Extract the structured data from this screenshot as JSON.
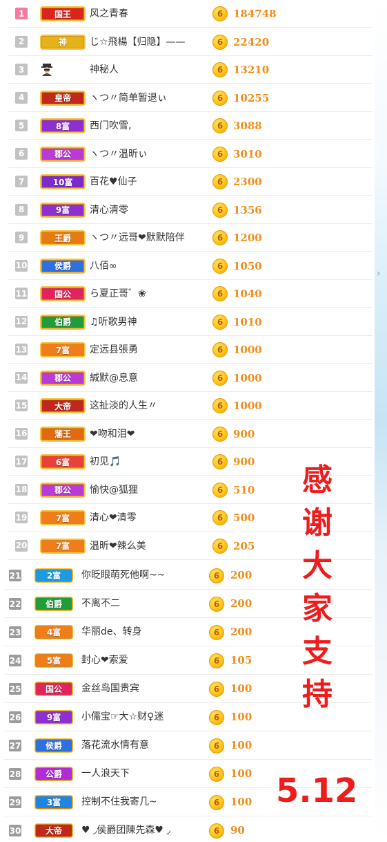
{
  "thanks_chars": [
    "感",
    "谢",
    "大",
    "家",
    "支",
    "持"
  ],
  "date_text": "5.12",
  "coin_glyph": "6",
  "rank_colors": {
    "top1": "#f47a9e",
    "upper": "#c2c2c2",
    "lower": "#9c9c9c"
  },
  "entries": [
    {
      "rank": "1",
      "badge": "国王",
      "badge_color": "#d9251d",
      "name": "风之青春",
      "score": "184748"
    },
    {
      "rank": "2",
      "badge": "神",
      "badge_color": "#e6b21a",
      "name": "じ☆飛楊【归隐】——",
      "score": "22420"
    },
    {
      "rank": "3",
      "badge": "",
      "badge_color": "",
      "name": "神秘人",
      "score": "13210",
      "icon": "mystery-person-icon"
    },
    {
      "rank": "4",
      "badge": "皇帝",
      "badge_color": "#c0281b",
      "name": "ヽつ〃简单暂退ぃ",
      "score": "10255"
    },
    {
      "rank": "5",
      "badge": "8富",
      "badge_color": "#8e2fd1",
      "name": "西门吹雪,",
      "score": "3088"
    },
    {
      "rank": "6",
      "badge": "郡公",
      "badge_color": "#b93ad6",
      "name": "ヽつ〃温昕ぃ",
      "score": "3010"
    },
    {
      "rank": "7",
      "badge": "10富",
      "badge_color": "#7b2bc9",
      "name": "百花♥仙子",
      "score": "2300"
    },
    {
      "rank": "8",
      "badge": "9富",
      "badge_color": "#8e2fd1",
      "name": "清心清零",
      "score": "1356"
    },
    {
      "rank": "9",
      "badge": "王爵",
      "badge_color": "#e67b12",
      "name": "ヽつ〃远哥❤默默陪伴",
      "score": "1200"
    },
    {
      "rank": "10",
      "badge": "侯爵",
      "badge_color": "#2f6fe0",
      "name": "八佰∞",
      "score": "1050"
    },
    {
      "rank": "11",
      "badge": "国公",
      "badge_color": "#e0245e",
      "name": "ら夏正哥゛❀",
      "score": "1040"
    },
    {
      "rank": "12",
      "badge": "伯爵",
      "badge_color": "#1f9d3a",
      "name": "♫听歌男神",
      "score": "1010"
    },
    {
      "rank": "13",
      "badge": "7富",
      "badge_color": "#f07d1a",
      "name": "定远县張勇",
      "score": "1000"
    },
    {
      "rank": "14",
      "badge": "郡公",
      "badge_color": "#b93ad6",
      "name": "緘默@息意",
      "score": "1000"
    },
    {
      "rank": "15",
      "badge": "大帝",
      "badge_color": "#c0281b",
      "name": "这扯淡的人生〃",
      "score": "1000"
    },
    {
      "rank": "16",
      "badge": "藩王",
      "badge_color": "#e06a10",
      "name": "❤吻和泪❤",
      "score": "900"
    },
    {
      "rank": "17",
      "badge": "6富",
      "badge_color": "#e8413a",
      "name": "初见🎵",
      "score": "900"
    },
    {
      "rank": "18",
      "badge": "郡公",
      "badge_color": "#b93ad6",
      "name": "愉快@狐狸",
      "score": "510"
    },
    {
      "rank": "19",
      "badge": "7富",
      "badge_color": "#f07d1a",
      "name": "清心❤清零",
      "score": "500"
    },
    {
      "rank": "20",
      "badge": "7富",
      "badge_color": "#f07d1a",
      "name": "温昕❤辣么美",
      "score": "205"
    },
    {
      "rank": "21",
      "badge": "2富",
      "badge_color": "#1e9be0",
      "name": "你眨眼萌死他啊~~",
      "score": "200"
    },
    {
      "rank": "22",
      "badge": "伯爵",
      "badge_color": "#1f9d3a",
      "name": "不离不二",
      "score": "200"
    },
    {
      "rank": "23",
      "badge": "4富",
      "badge_color": "#f07d1a",
      "name": "华丽de、转身",
      "score": "200"
    },
    {
      "rank": "24",
      "badge": "5富",
      "badge_color": "#f07d1a",
      "name": "封心❤索爱",
      "score": "105"
    },
    {
      "rank": "25",
      "badge": "国公",
      "badge_color": "#e0245e",
      "name": "金丝鸟国贵宾",
      "score": "100"
    },
    {
      "rank": "26",
      "badge": "9富",
      "badge_color": "#8e2fd1",
      "name": "小儒宝☞大☆财♀迷",
      "score": "100"
    },
    {
      "rank": "27",
      "badge": "侯爵",
      "badge_color": "#2f6fe0",
      "name": "落花流水情有意",
      "score": "100"
    },
    {
      "rank": "28",
      "badge": "公爵",
      "badge_color": "#b12bd6",
      "name": "一人浪天下",
      "score": "100"
    },
    {
      "rank": "29",
      "badge": "3富",
      "badge_color": "#1e86e0",
      "name": "控制不住我寄几~",
      "score": "100"
    },
    {
      "rank": "30",
      "badge": "大帝",
      "badge_color": "#c0281b",
      "name": "♥ ◞侯爵团陳先森♥ ◞",
      "score": "90"
    }
  ]
}
